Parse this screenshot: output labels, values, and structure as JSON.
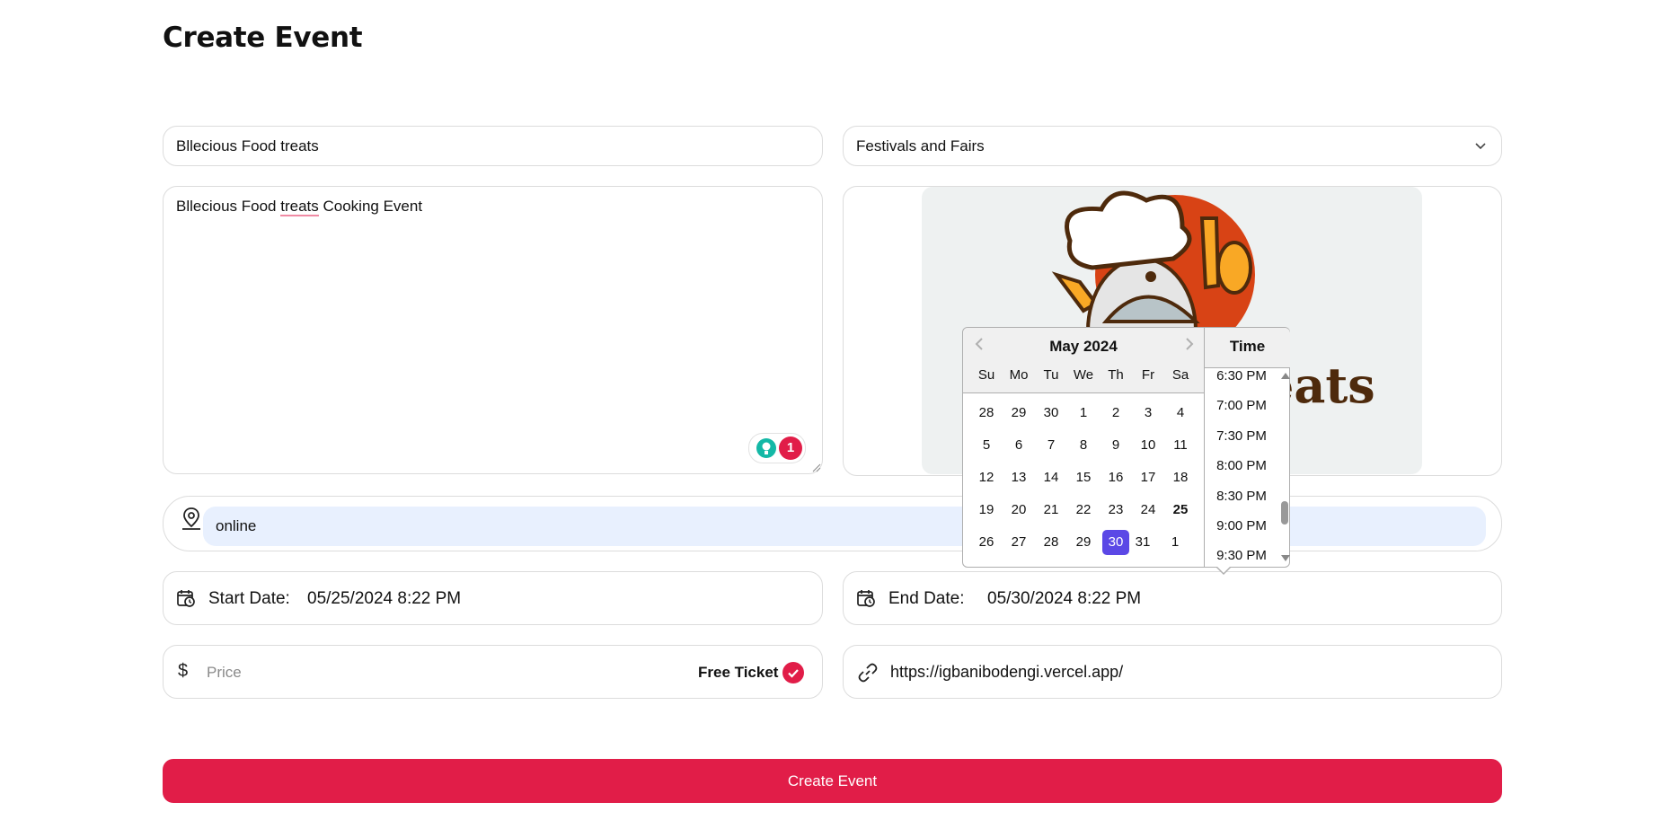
{
  "page": {
    "title": "Create Event"
  },
  "form": {
    "title_value": "Bllecious Food treats",
    "category_value": "Festivals and Fairs",
    "description_parts": [
      "Bllecious Food ",
      "treats",
      " Cooking Event"
    ],
    "grammar_count": "1",
    "image_logo_text": "eats",
    "location_value": "online",
    "start_label": "Start Date:",
    "start_value": "05/25/2024 8:22 PM",
    "end_label": "End Date:",
    "end_value": "05/30/2024 8:22 PM",
    "price_placeholder": "Price",
    "price_symbol": "$",
    "free_ticket_label": "Free Ticket",
    "free_ticket_checked": true,
    "url_value": "https://igbanibodengi.vercel.app/",
    "submit_label": "Create Event"
  },
  "datepicker": {
    "month_label": "May 2024",
    "weekday_labels": [
      "Su",
      "Mo",
      "Tu",
      "We",
      "Th",
      "Fr",
      "Sa"
    ],
    "weeks": [
      [
        "28",
        "29",
        "30",
        "1",
        "2",
        "3",
        "4"
      ],
      [
        "5",
        "6",
        "7",
        "8",
        "9",
        "10",
        "11"
      ],
      [
        "12",
        "13",
        "14",
        "15",
        "16",
        "17",
        "18"
      ],
      [
        "19",
        "20",
        "21",
        "22",
        "23",
        "24",
        "25"
      ],
      [
        "26",
        "27",
        "28",
        "29",
        "30",
        "31",
        "1"
      ]
    ],
    "today": "25",
    "selected": "30",
    "time_header": "Time",
    "times": [
      "6:30 PM",
      "7:00 PM",
      "7:30 PM",
      "8:00 PM",
      "8:30 PM",
      "9:00 PM",
      "9:30 PM"
    ]
  },
  "colors": {
    "accent": "#e11d48",
    "selected_day": "#5b48e6",
    "location_fill": "#e8f0fe",
    "grammar_bulb": "#14b8a6"
  },
  "icons": {
    "category_chevron": "chevron-down-icon",
    "location": "map-pin-icon",
    "start_date": "calendar-clock-icon",
    "end_date": "calendar-clock-icon",
    "link": "link-icon",
    "free_ticket": "check-circle-icon"
  }
}
